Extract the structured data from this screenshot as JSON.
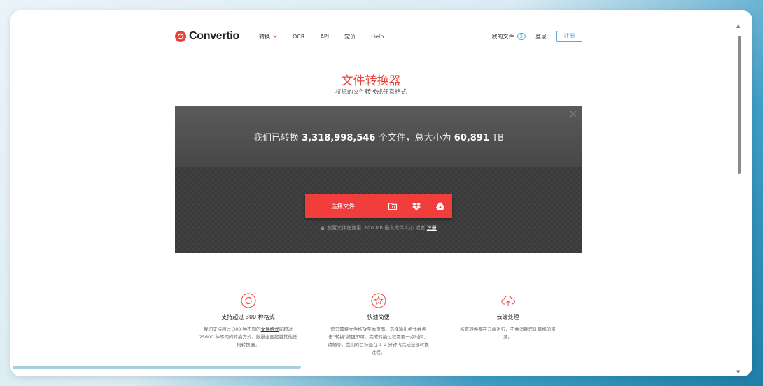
{
  "header": {
    "logo_text": "Convertio",
    "nav": [
      "转换",
      "OCR",
      "API",
      "定价",
      "Help"
    ],
    "my_files_label": "我的文件",
    "my_files_count": "3",
    "login_label": "登录",
    "signup_label": "注册"
  },
  "hero": {
    "title": "文件转换器",
    "subtitle": "将您的文件转换成任意格式"
  },
  "stats": {
    "prefix": "我们已转换",
    "files_count": "3,318,998,546",
    "middle": "个文件，总大小为",
    "total_size": "60,891",
    "unit": "TB"
  },
  "converter": {
    "choose_files_label": "选择文件",
    "drop_note_text": "放置文件在这里. 100 MB 最大文件大小 或者",
    "drop_note_link": "注册"
  },
  "features": [
    {
      "icon": "refresh-icon",
      "title": "支持超过 300 种格式",
      "text_before": "我们支持超过 300 种不同的",
      "link": "文件格式",
      "text_after": "间超过 25600 种不同的转换方式。数量全面超越其他任何转换器。"
    },
    {
      "icon": "star-icon",
      "title": "快速简便",
      "text": "您只需将文件拖放至本页面，选择输出格式并点击\"转换\"按钮即可。完成转换过程需要一点时间，请稍等。我们的目标是在 1-2 分钟内完成全部转换过程。"
    },
    {
      "icon": "cloud-upload-icon",
      "title": "云端处理",
      "text": "所有转换都在云端进行，不会消耗您计算机的资源。"
    }
  ],
  "colors": {
    "brand_red": "#f23d3d",
    "title_red": "#e8413a",
    "link_blue": "#5aa8e0",
    "panel_dark": "#3a3a3a"
  }
}
